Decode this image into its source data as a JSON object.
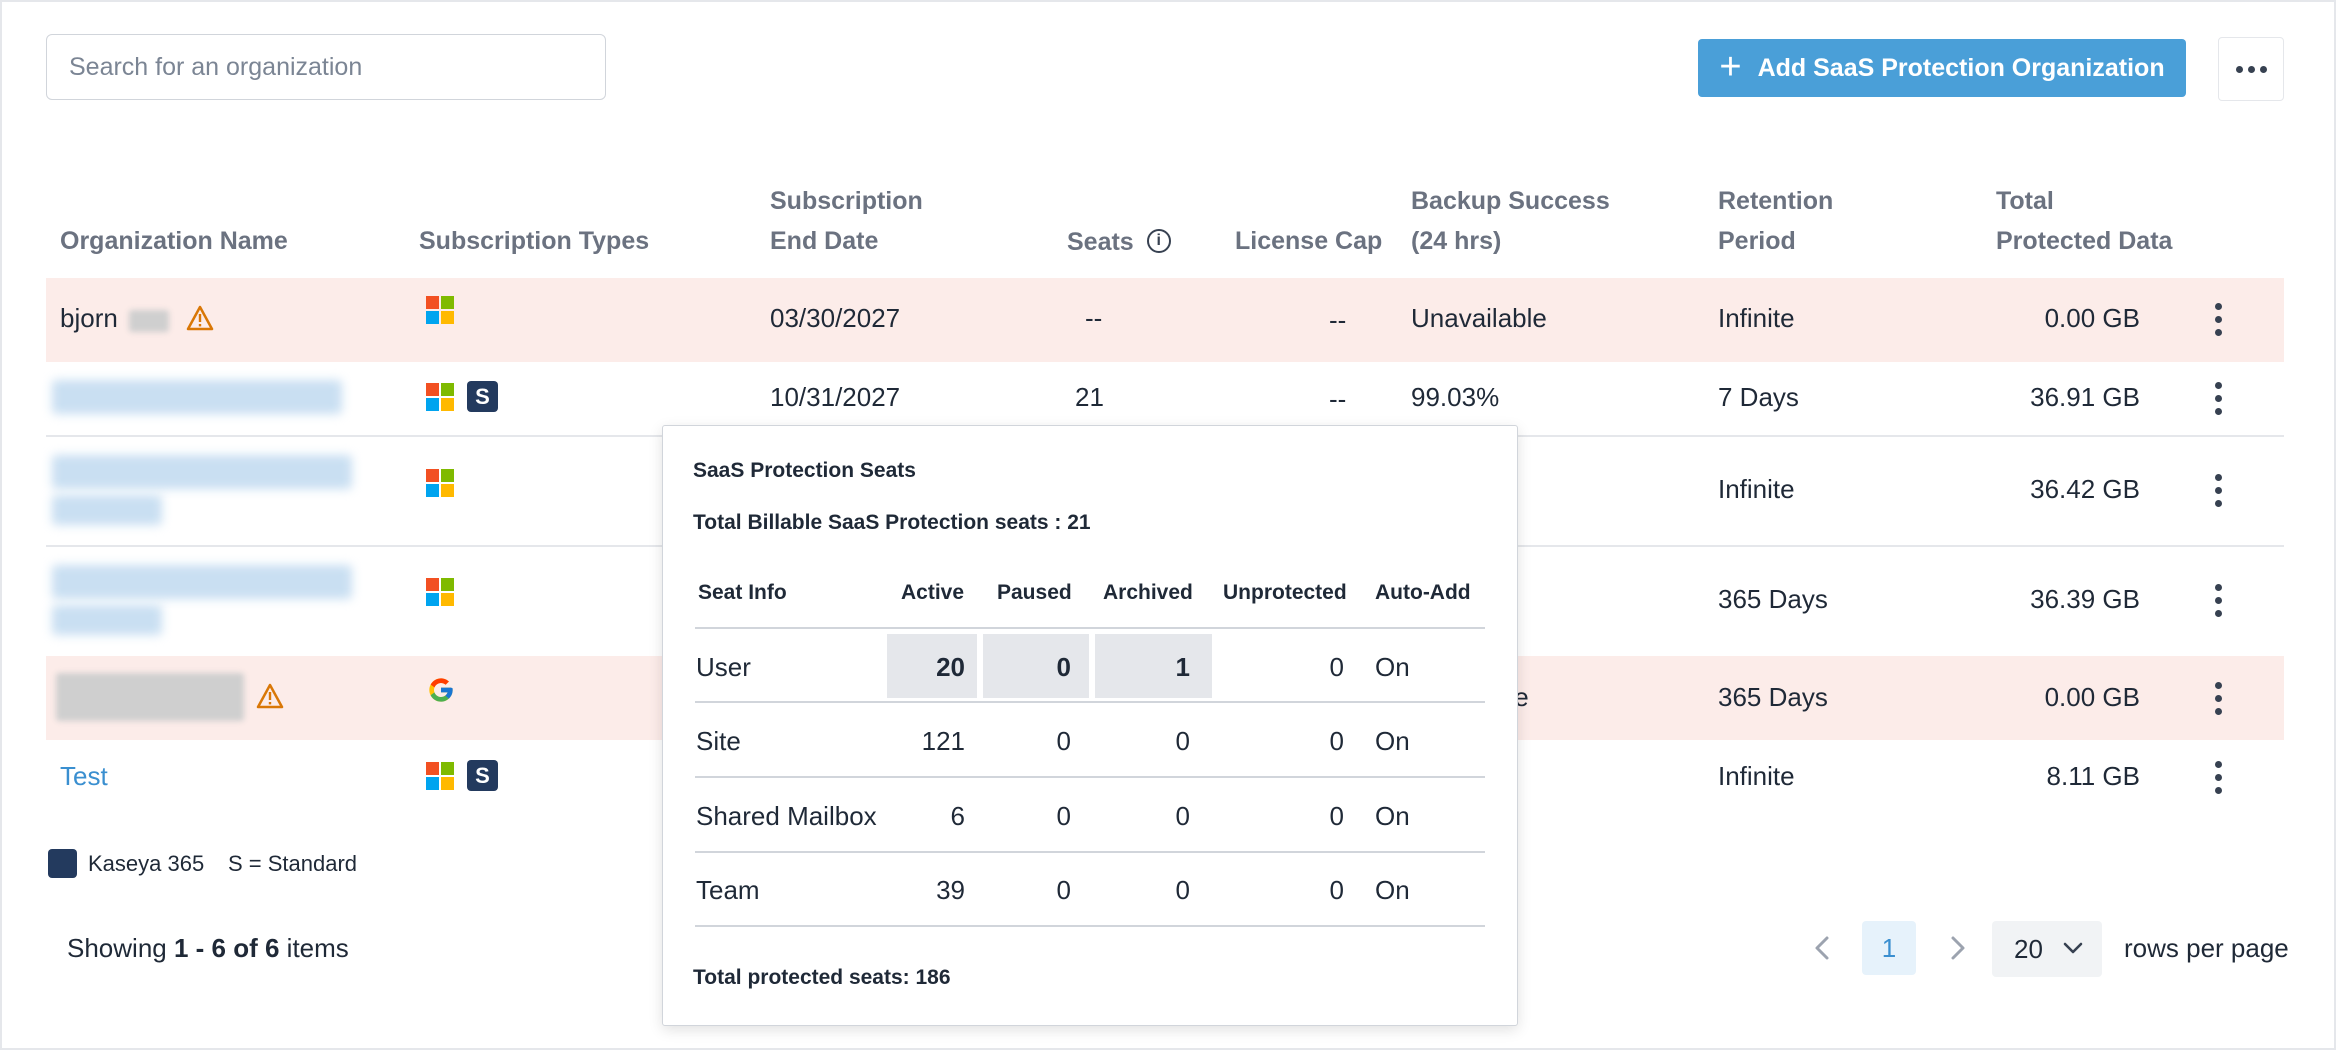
{
  "search": {
    "placeholder": "Search for an organization"
  },
  "toolbar": {
    "add_label": "Add SaaS Protection Organization"
  },
  "table": {
    "headers": {
      "org_name": "Organization Name",
      "sub_types": "Subscription Types",
      "end_date_1": "Subscription",
      "end_date_2": "End Date",
      "seats": "Seats",
      "license_cap": "License Cap",
      "backup_1": "Backup Success",
      "backup_2": "(24 hrs)",
      "retention_1": "Retention",
      "retention_2": "Period",
      "total_1": "Total",
      "total_2": "Protected Data"
    },
    "rows": [
      {
        "name": "bjorn",
        "end_date": "03/30/2027",
        "seats": "--",
        "license_cap": "--",
        "backup": "Unavailable",
        "retention": "Infinite",
        "total": "0.00 GB"
      },
      {
        "name": "",
        "end_date": "10/31/2027",
        "seats": "21",
        "license_cap": "--",
        "backup": "99.03%",
        "retention": "7 Days",
        "total": "36.91 GB"
      },
      {
        "name": "",
        "retention": "Infinite",
        "total": "36.42 GB"
      },
      {
        "name": "",
        "retention": "365 Days",
        "total": "36.39 GB"
      },
      {
        "name": "",
        "backup_partial": "ble",
        "retention": "365 Days",
        "total": "0.00 GB"
      },
      {
        "name": "Test",
        "retention": "Infinite",
        "total": "8.11 GB"
      }
    ]
  },
  "legend": {
    "kaseya": "Kaseya 365",
    "standard": "S = Standard",
    "s_badge": "S"
  },
  "footer": {
    "showing_prefix": "Showing ",
    "showing_range": "1 - 6 of 6",
    "showing_suffix": " items",
    "page": "1",
    "rows_per_page_value": "20",
    "rows_per_page_label": "rows per page"
  },
  "popover": {
    "title": "SaaS Protection Seats",
    "billable": "Total Billable SaaS Protection seats : 21",
    "columns": [
      "Seat Info",
      "Active",
      "Paused",
      "Archived",
      "Unprotected",
      "Auto-Add"
    ],
    "rows": [
      {
        "info": "User",
        "active": "20",
        "paused": "0",
        "archived": "1",
        "unprotected": "0",
        "auto_add": "On"
      },
      {
        "info": "Site",
        "active": "121",
        "paused": "0",
        "archived": "0",
        "unprotected": "0",
        "auto_add": "On"
      },
      {
        "info": "Shared Mailbox",
        "active": "6",
        "paused": "0",
        "archived": "0",
        "unprotected": "0",
        "auto_add": "On"
      },
      {
        "info": "Team",
        "active": "39",
        "paused": "0",
        "archived": "0",
        "unprotected": "0",
        "auto_add": "On"
      }
    ],
    "total": "Total protected seats: 186"
  },
  "colors": {
    "accent": "#4a9fd8",
    "warn_row": "#fcece9",
    "badge": "#233a5e",
    "warning_icon": "#d97706"
  },
  "icons": [
    "plus-icon",
    "more-horizontal-icon",
    "info-icon",
    "warning-icon",
    "microsoft-icon",
    "google-icon",
    "kebab-icon",
    "chevron-left-icon",
    "chevron-right-icon",
    "chevron-down-icon"
  ]
}
